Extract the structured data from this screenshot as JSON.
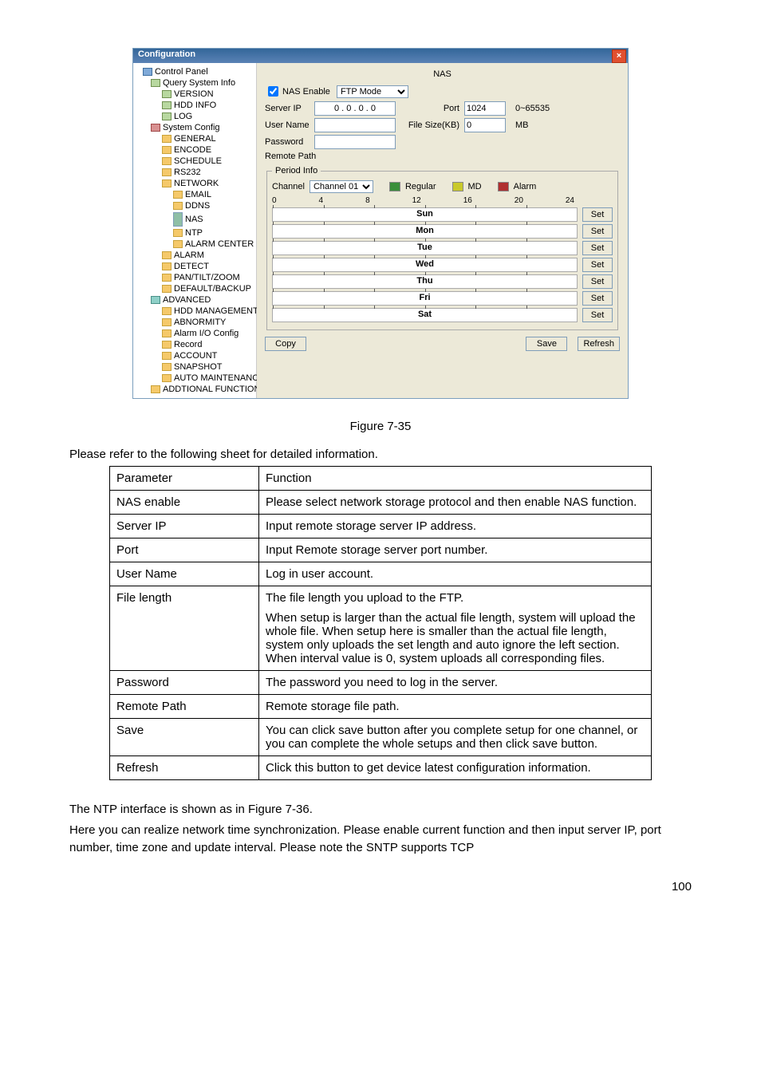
{
  "page_number": "100",
  "figure_caption": "Figure 7-35",
  "intro": "Please refer to the following sheet for detailed information.",
  "body1": "The NTP interface is shown as in Figure 7-36.",
  "body2": "Here you can realize network time synchronization. Please enable current function and then input server IP, port number, time zone and update interval. Please note the SNTP supports TCP",
  "win": {
    "title": "Configuration",
    "close": "×",
    "panel_title": "NAS",
    "tree": {
      "control": "Control Panel",
      "qsi": "Query System Info",
      "version": "VERSION",
      "hdd": "HDD INFO",
      "log": "LOG",
      "sys": "System Config",
      "general": "GENERAL",
      "encode": "ENCODE",
      "schedule": "SCHEDULE",
      "rs232": "RS232",
      "network": "NETWORK",
      "email": "EMAIL",
      "ddns": "DDNS",
      "nas": "NAS",
      "ntp": "NTP",
      "alarmcenter": "ALARM CENTER",
      "alarm": "ALARM",
      "detect": "DETECT",
      "ptz": "PAN/TILT/ZOOM",
      "default": "DEFAULT/BACKUP",
      "advanced": "ADVANCED",
      "hddm": "HDD MANAGEMENT",
      "abnorm": "ABNORMITY",
      "aio": "Alarm I/O Config",
      "record": "Record",
      "account": "ACCOUNT",
      "snapshot": "SNAPSHOT",
      "automaint": "AUTO MAINTENANCE",
      "addf": "ADDTIONAL FUNCTION"
    },
    "form": {
      "nas_enable": "NAS Enable",
      "ftp_mode": "FTP Mode",
      "server_ip": "Server IP",
      "ipval": "0 . 0 . 0 . 0",
      "port_l": "Port",
      "port_v": "1024",
      "port_r": "0~65535",
      "user": "User Name",
      "filesize_l": "File Size(KB)",
      "filesize_v": "0",
      "filesize_u": "MB",
      "password": "Password",
      "remote": "Remote Path",
      "period": "Period Info",
      "channel_l": "Channel",
      "channel_v": "Channel 01",
      "regular": "Regular",
      "md": "MD",
      "alarm": "Alarm",
      "axis": {
        "t0": "0",
        "t4": "4",
        "t8": "8",
        "t12": "12",
        "t16": "16",
        "t20": "20",
        "t24": "24"
      },
      "days": {
        "sun": "Sun",
        "mon": "Mon",
        "tue": "Tue",
        "wed": "Wed",
        "thu": "Thu",
        "fri": "Fri",
        "sat": "Sat"
      },
      "set": "Set",
      "copy": "Copy",
      "save": "Save",
      "refresh": "Refresh"
    }
  },
  "table": {
    "h1": "Parameter",
    "h2": "Function",
    "rows": [
      {
        "p": "NAS enable",
        "f": "Please select network storage protocol and then enable NAS function."
      },
      {
        "p": "Server IP",
        "f": "Input remote storage server IP address."
      },
      {
        "p": "Port",
        "f": "Input Remote storage server port number."
      },
      {
        "p": "User Name",
        "f": "Log in user account."
      },
      {
        "p": "File length",
        "f_a": "The file length you upload to the FTP.",
        "f_b": "When setup is larger than the actual file length, system will upload the whole file. When setup here is smaller than the actual file length, system only uploads the set length and auto ignore the left section. When interval value is 0, system uploads all corresponding files."
      },
      {
        "p": "Password",
        "f": "The password you need to log in the server."
      },
      {
        "p": "Remote Path",
        "f": "Remote storage file path."
      },
      {
        "p": "Save",
        "f": "You can click save button after you complete setup for one channel, or you can complete the whole setups and then click save button."
      },
      {
        "p": "Refresh",
        "f": "Click this button to get device latest configuration information."
      }
    ]
  }
}
